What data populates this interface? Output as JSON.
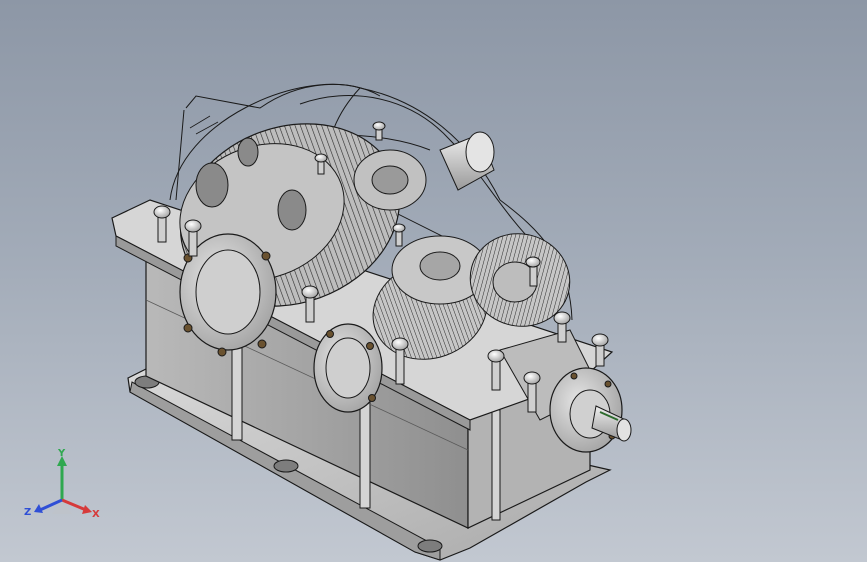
{
  "viewport": {
    "background_top": "#8d97a6",
    "background_bottom": "#c2c8d1"
  },
  "model": {
    "subject": "gear reducer",
    "body_color": "#c9c9c9",
    "shade_color": "#9c9c9c",
    "edge_color": "#1a1a1a",
    "transparent_cover": true
  },
  "triad": {
    "x_label": "X",
    "y_label": "Y",
    "z_label": "Z",
    "x_color": "#d63a3a",
    "y_color": "#2fa84f",
    "z_color": "#2f4fd6"
  }
}
